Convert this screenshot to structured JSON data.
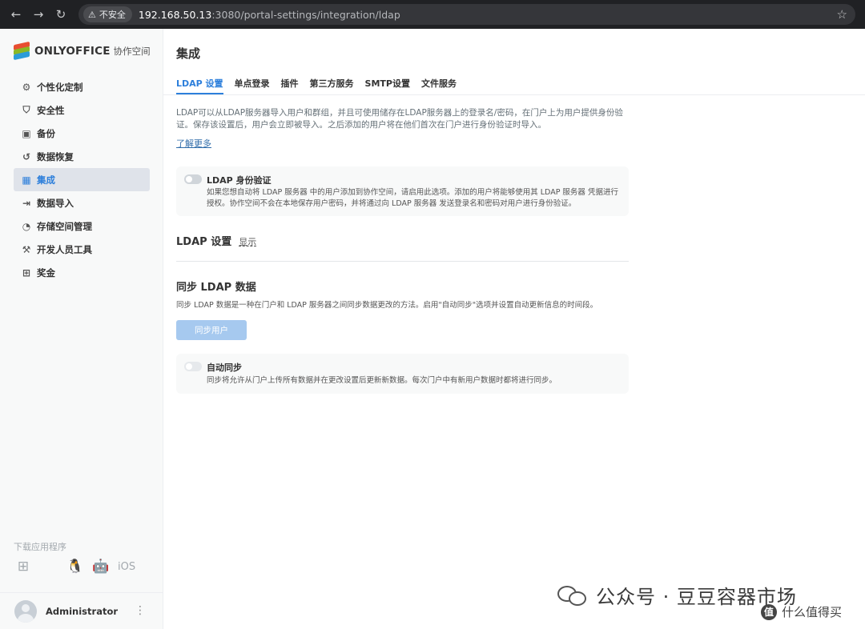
{
  "browser": {
    "back_icon": "←",
    "forward_icon": "→",
    "reload_icon": "↻",
    "warning_icon": "⚠",
    "security_label": "不安全",
    "url_host": "192.168.50.13",
    "url_path": ":3080/portal-settings/integration/ldap",
    "star_icon": "☆"
  },
  "sidebar": {
    "logo_text": "ONLYOFFICE",
    "logo_sub": "协作空间",
    "items": [
      {
        "label": "个性化定制",
        "icon": "⚙"
      },
      {
        "label": "安全性",
        "icon": "⛉"
      },
      {
        "label": "备份",
        "icon": "▣"
      },
      {
        "label": "数据恢复",
        "icon": "↺"
      },
      {
        "label": "集成",
        "icon": "▦"
      },
      {
        "label": "数据导入",
        "icon": "⇥"
      },
      {
        "label": "存储空间管理",
        "icon": "◔"
      },
      {
        "label": "开发人员工具",
        "icon": "⚒"
      },
      {
        "label": "奖金",
        "icon": "⊞"
      }
    ],
    "apps_label": "下载应用程序",
    "apps": {
      "windows": "⊞",
      "macos": "",
      "linux": "🐧",
      "android": "🤖",
      "ios": "iOS"
    },
    "user": {
      "name": "Administrator",
      "more_icon": "⋮"
    }
  },
  "main": {
    "title": "集成",
    "tabs": [
      "LDAP 设置",
      "单点登录",
      "插件",
      "第三方服务",
      "SMTP设置",
      "文件服务"
    ],
    "intro": "LDAP可以从LDAP服务器导入用户和群组，并且可使用储存在LDAP服务器上的登录名/密码，在门户上为用户提供身份验证。保存该设置后，用户会立即被导入。之后添加的用户将在他们首次在门户进行身份验证时导入。",
    "learn_more": "了解更多",
    "ldap_auth": {
      "title": "LDAP 身份验证",
      "desc": "如果您想自动将 LDAP 服务器 中的用户添加到协作空间，请启用此选项。添加的用户将能够使用其 LDAP 服务器 凭据进行授权。协作空间不会在本地保存用户密码，并将通过向 LDAP 服务器 发送登录名和密码对用户进行身份验证。",
      "enabled": false
    },
    "ldap_settings": {
      "title": "LDAP 设置",
      "show": "显示"
    },
    "sync": {
      "title": "同步 LDAP 数据",
      "desc": "同步 LDAP 数据是一种在门户和 LDAP 服务器之间同步数据更改的方法。启用\"自动同步\"选项并设置自动更新信息的时间段。",
      "button": "同步用户"
    },
    "auto_sync": {
      "title": "自动同步",
      "desc": "同步将允许从门户上传所有数据并在更改设置后更新新数据。每次门户中有新用户数据时都将进行同步。",
      "enabled": false
    }
  },
  "watermark": {
    "text": "公众号 · 豆豆容器市场",
    "badge": "值",
    "sub": "什么值得买"
  },
  "colors": {
    "accent": "#2d7fdb",
    "sync_button": "#a6c9ef",
    "sidebar_bg": "#f8f9f9"
  }
}
